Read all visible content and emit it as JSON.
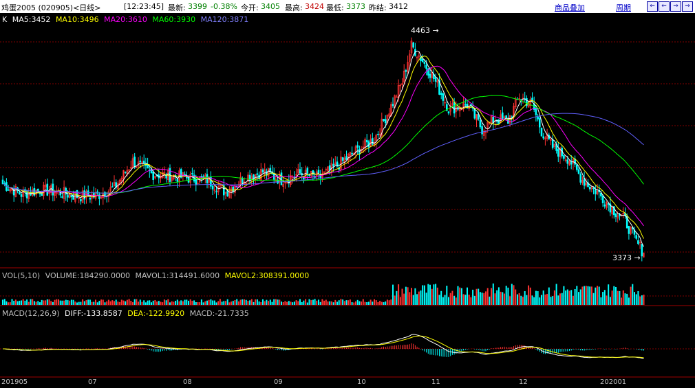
{
  "header": {
    "title": "鸡蛋2005 (020905)<日线>",
    "time": "[12:23:45]",
    "latest_label": "最新:",
    "latest": "3399",
    "change": "-0.38%",
    "open_label": "今开:",
    "open": "3405",
    "high_label": "最高:",
    "high": "3424",
    "low_label": "最低:",
    "low": "3373",
    "prev_label": "昨结:",
    "prev": "3412",
    "overlay_link": "商品叠加",
    "period_link": "周期",
    "nav_buttons": [
      "⇐",
      "⇐",
      "⇒",
      "⇒",
      "⇒"
    ]
  },
  "ma_legend": {
    "k": "K",
    "ma5": "MA5:3452",
    "ma10": "MA10:3496",
    "ma20": "MA20:3610",
    "ma60": "MA60:3930",
    "ma120": "MA120:3871"
  },
  "vol_legend": {
    "name": "VOL(5,10)",
    "volume": "VOLUME:184290.0000",
    "mavol1": "MAVOL1:314491.6000",
    "mavol2": "MAVOL2:308391.0000"
  },
  "macd_legend": {
    "name": "MACD(12,26,9)",
    "diff": "DIFF:-133.8587",
    "dea": "DEA:-122.9920",
    "macd": "MACD:-21.7335"
  },
  "annotations": {
    "high_mark": "4463",
    "low_mark": "3373"
  },
  "x_labels": [
    "201905",
    "07",
    "08",
    "09",
    "10",
    "11",
    "12",
    "202001"
  ],
  "colors": {
    "up": "#ff3232",
    "down": "#00ffff",
    "ma5": "#ffffff",
    "ma10": "#ffff00",
    "ma20": "#ff00ff",
    "ma60": "#00ff00",
    "ma120": "#6060ff",
    "grid": "#800000"
  },
  "chart_data": {
    "type": "candlestick",
    "y_range": [
      3330,
      4520
    ],
    "high_point": 4463,
    "low_point": 3373,
    "keypoints": [
      [
        0,
        3740
      ],
      [
        10,
        3690
      ],
      [
        20,
        3710
      ],
      [
        30,
        3700
      ],
      [
        40,
        3680
      ],
      [
        50,
        3680
      ],
      [
        60,
        3720
      ],
      [
        70,
        3850
      ],
      [
        80,
        3790
      ],
      [
        90,
        3780
      ],
      [
        100,
        3770
      ],
      [
        110,
        3760
      ],
      [
        120,
        3700
      ],
      [
        130,
        3770
      ],
      [
        140,
        3800
      ],
      [
        150,
        3760
      ],
      [
        160,
        3790
      ],
      [
        170,
        3770
      ],
      [
        180,
        3830
      ],
      [
        190,
        3900
      ],
      [
        200,
        3960
      ],
      [
        210,
        4140
      ],
      [
        215,
        4240
      ],
      [
        220,
        4420
      ],
      [
        225,
        4360
      ],
      [
        232,
        4260
      ],
      [
        240,
        4110
      ],
      [
        250,
        4130
      ],
      [
        258,
        4010
      ],
      [
        265,
        4060
      ],
      [
        272,
        4050
      ],
      [
        278,
        4170
      ],
      [
        285,
        4130
      ],
      [
        290,
        4000
      ],
      [
        296,
        3920
      ],
      [
        305,
        3860
      ],
      [
        312,
        3760
      ],
      [
        320,
        3700
      ],
      [
        328,
        3620
      ],
      [
        335,
        3560
      ],
      [
        340,
        3470
      ],
      [
        345,
        3399
      ]
    ],
    "macd_range": [
      -240,
      240
    ]
  }
}
